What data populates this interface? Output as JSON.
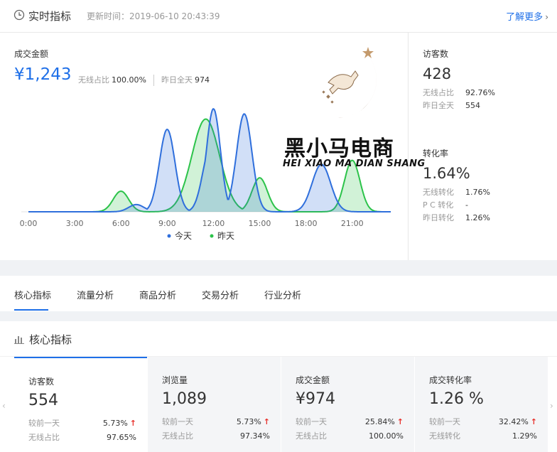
{
  "realtime": {
    "title": "实时指标",
    "update_label": "更新时间：2019-06-10 20:43:39",
    "more_link": "了解更多"
  },
  "gmv": {
    "label": "成交金额",
    "value": "¥1,243",
    "wireless_label": "无线占比",
    "wireless_value": "100.00%",
    "yesterday_label": "昨日全天",
    "yesterday_value": "974"
  },
  "visitors": {
    "label": "访客数",
    "value": "428",
    "rows": [
      {
        "key": "无线占比",
        "value": "92.76%"
      },
      {
        "key": "昨日全天",
        "value": "554"
      }
    ]
  },
  "conversion": {
    "label": "转化率",
    "value": "1.64%",
    "rows": [
      {
        "key": "无线转化",
        "value": "1.76%"
      },
      {
        "key": "P C 转化",
        "value": "-"
      },
      {
        "key": "昨日转化",
        "value": "1.26%"
      }
    ]
  },
  "chart_data": {
    "type": "area",
    "x_ticks": [
      "0:00",
      "3:00",
      "6:00",
      "9:00",
      "12:00",
      "15:00",
      "18:00",
      "21:00"
    ],
    "x_range": [
      0,
      23.5
    ],
    "y_range": [
      0,
      100
    ],
    "grid": false,
    "legend_position": "bottom",
    "series": [
      {
        "name": "今天",
        "color": "#2f6fdc",
        "peaks": [
          {
            "hour": 7.0,
            "height": 7,
            "width": 0.5
          },
          {
            "hour": 9.0,
            "height": 80,
            "width": 0.5
          },
          {
            "hour": 11.8,
            "height": 62,
            "width": 0.5
          },
          {
            "hour": 12.0,
            "height": 100,
            "width": 0.45
          },
          {
            "hour": 14.0,
            "height": 95,
            "width": 0.5
          },
          {
            "hour": 19.0,
            "height": 46,
            "width": 0.6
          }
        ]
      },
      {
        "name": "昨天",
        "color": "#2cc34a",
        "peaks": [
          {
            "hour": 6.0,
            "height": 20,
            "width": 0.5
          },
          {
            "hour": 11.5,
            "height": 90,
            "width": 0.9
          },
          {
            "hour": 15.0,
            "height": 33,
            "width": 0.5
          },
          {
            "hour": 21.0,
            "height": 50,
            "width": 0.5
          }
        ]
      }
    ]
  },
  "tabs": [
    {
      "label": "核心指标",
      "active": true
    },
    {
      "label": "流量分析",
      "active": false
    },
    {
      "label": "商品分析",
      "active": false
    },
    {
      "label": "交易分析",
      "active": false
    },
    {
      "label": "行业分析",
      "active": false
    }
  ],
  "core": {
    "title": "核心指标",
    "cards": [
      {
        "label": "访客数",
        "value": "554",
        "row1_key": "较前一天",
        "row1_value": "5.73%",
        "row2_key": "无线占比",
        "row2_value": "97.65%",
        "selected": true
      },
      {
        "label": "浏览量",
        "value": "1,089",
        "row1_key": "较前一天",
        "row1_value": "5.73%",
        "row2_key": "无线占比",
        "row2_value": "97.34%",
        "selected": false
      },
      {
        "label": "成交金额",
        "value": "¥974",
        "row1_key": "较前一天",
        "row1_value": "25.84%",
        "row2_key": "无线占比",
        "row2_value": "100.00%",
        "selected": false
      },
      {
        "label": "成交转化率",
        "value": "1.26 %",
        "row1_key": "较前一天",
        "row1_value": "32.42%",
        "row2_key": "无线转化",
        "row2_value": "1.29%",
        "selected": false
      }
    ]
  },
  "watermark": {
    "cn_text": "黑小马电商",
    "en_text": "HEI XIAO MA DIAN SHANG"
  },
  "icons": {
    "clock": "clock-icon",
    "bars": "bar-chart-icon",
    "more_chevron": "›",
    "up_arrow": "↑",
    "left_arrow": "‹",
    "right_arrow": "›"
  },
  "colors": {
    "accent": "#1e6fe8",
    "today_series": "#2f6fdc",
    "yesterday_series": "#2cc34a",
    "up_arrow": "#e8322d"
  }
}
